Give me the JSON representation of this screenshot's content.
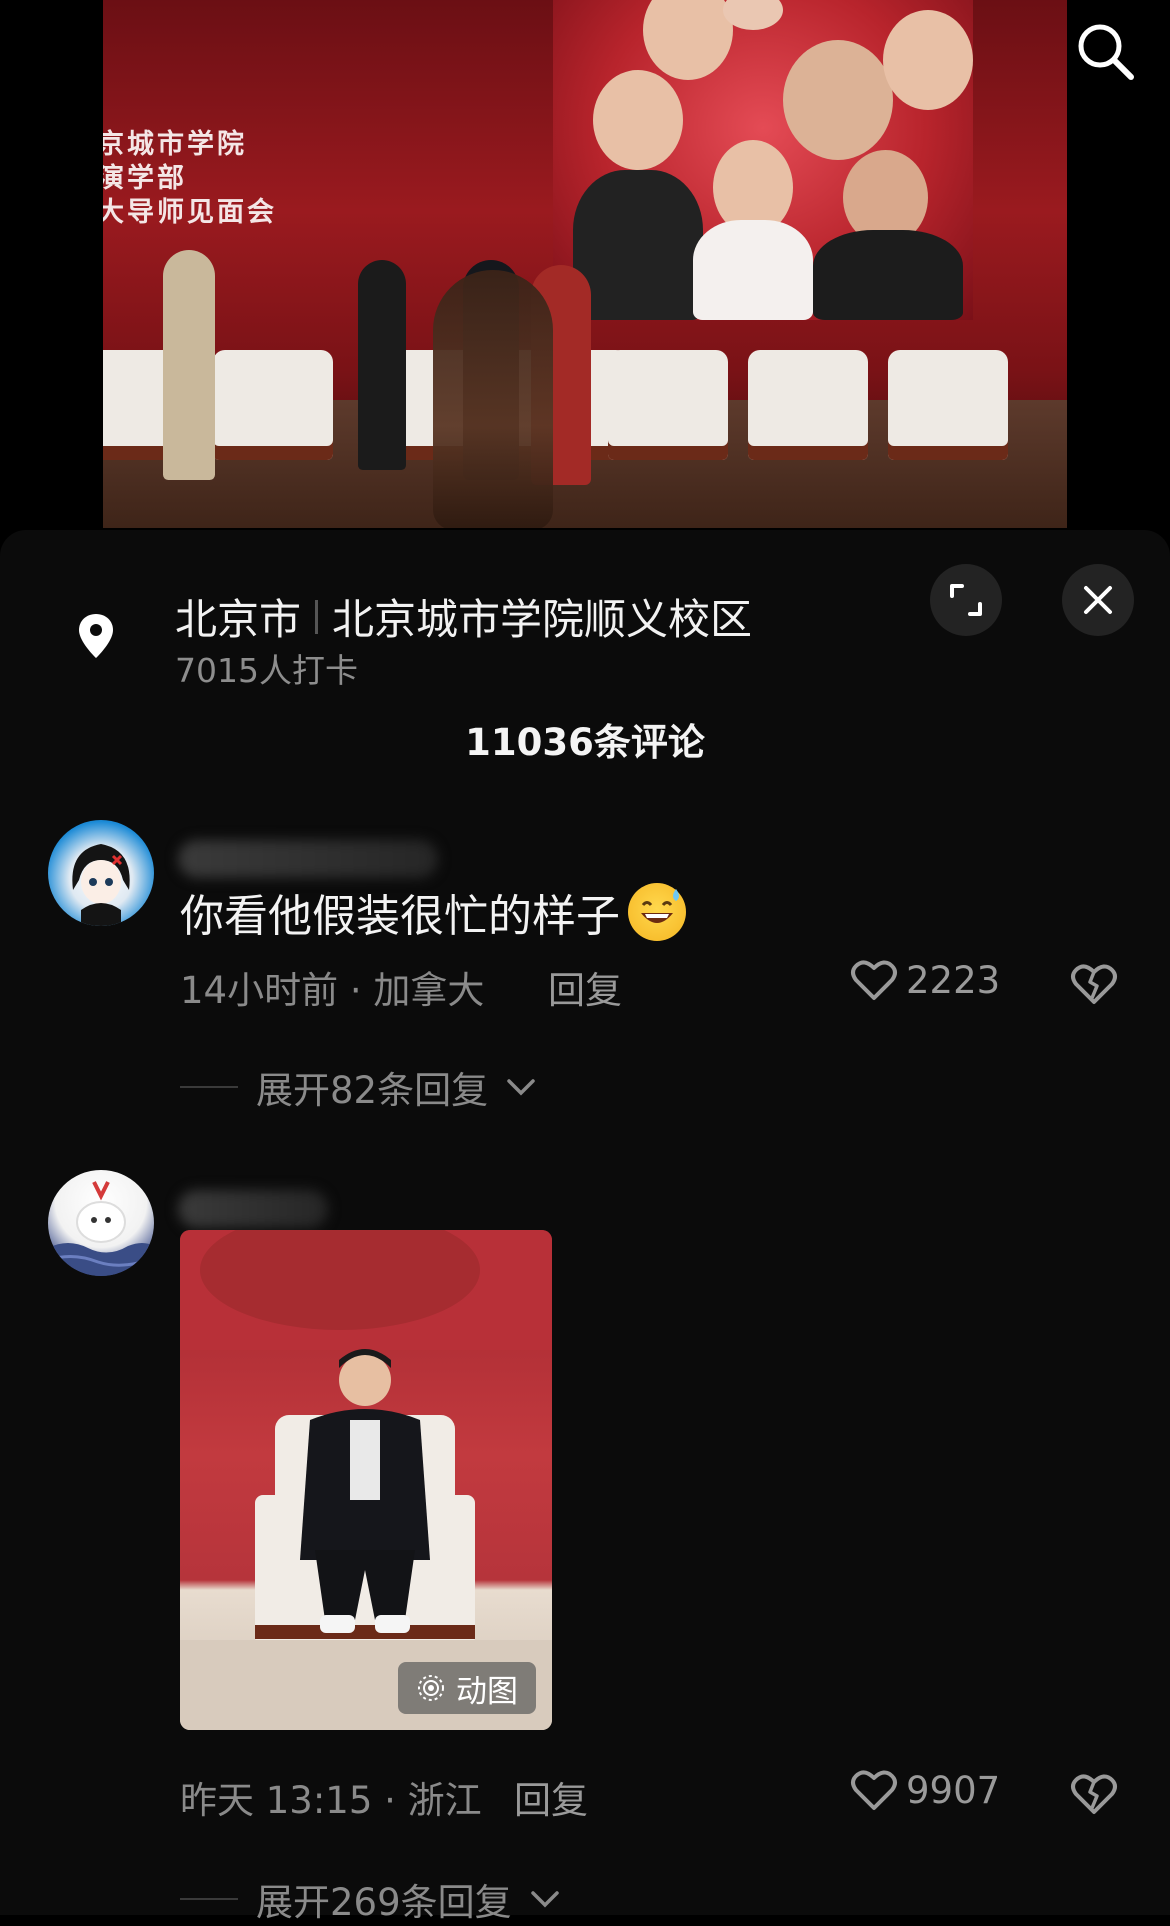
{
  "video": {
    "banner_text": "京城市学院\n演学部\n大导师见面会"
  },
  "header": {
    "search_icon": "search-icon"
  },
  "location": {
    "city": "北京市",
    "place": "北京城市学院顺义校区",
    "checkins": "7015人打卡",
    "expand_icon": "expand-icon",
    "close_icon": "close-icon"
  },
  "comments_header": {
    "count_label": "11036条评论"
  },
  "comments": [
    {
      "text": "你看他假装很忙的样子",
      "emoji": "sweat-smile-emoji",
      "meta": "14小时前 · 加拿大",
      "reply_label": "回复",
      "likes": "2223",
      "expand_label": "展开82条回复"
    },
    {
      "gif_label": "动图",
      "meta": "昨天 13:15 · 浙江",
      "reply_label": "回复",
      "likes": "9907",
      "expand_label": "展开269条回复"
    }
  ],
  "colors": {
    "background": "#000000",
    "sheet": "#0b0b0b",
    "secondary_text": "#8a8a8a"
  }
}
